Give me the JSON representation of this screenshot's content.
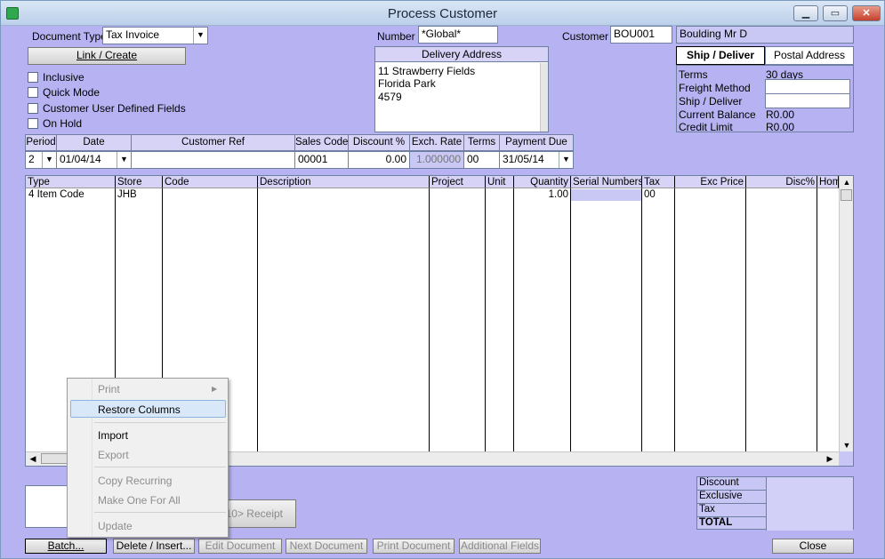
{
  "window": {
    "title": "Process Customer",
    "close_glyph": "✕",
    "max_glyph": "▭",
    "min_glyph": "▁"
  },
  "doc_type": {
    "label": "Document Type",
    "value": "Tax Invoice"
  },
  "link_create_label": "Link / Create",
  "options": [
    {
      "label": "Inclusive",
      "checked": false
    },
    {
      "label": "Quick Mode",
      "checked": false
    },
    {
      "label": "Customer User Defined Fields",
      "checked": false
    },
    {
      "label": "On Hold",
      "checked": false
    }
  ],
  "number": {
    "label": "Number",
    "value": "*Global*"
  },
  "delivery": {
    "title": "Delivery Address",
    "lines": [
      "11 Strawberry Fields",
      "Florida Park",
      "4579"
    ]
  },
  "customer": {
    "label": "Customer",
    "code": "BOU001",
    "name": "Boulding Mr D"
  },
  "address_tabs": {
    "ship": "Ship / Deliver",
    "postal": "Postal Address"
  },
  "cust_info": {
    "terms_label": "Terms",
    "terms_value": "30 days",
    "freight_label": "Freight Method",
    "freight_value": "",
    "ship_label": "Ship / Deliver",
    "ship_value": "",
    "balance_label": "Current Balance",
    "balance_value": "R0.00",
    "credit_label": "Credit Limit",
    "credit_value": "R0.00"
  },
  "header_row": {
    "period": {
      "label": "Period",
      "value": "2"
    },
    "date": {
      "label": "Date",
      "value": "01/04/14"
    },
    "customer_ref": {
      "label": "Customer Ref",
      "value": ""
    },
    "sales_code": {
      "label": "Sales Code",
      "value": "00001"
    },
    "discount": {
      "label": "Discount %",
      "value": "0.00"
    },
    "exch_rate": {
      "label": "Exch. Rate",
      "value": "1.000000"
    },
    "terms": {
      "label": "Terms",
      "value": "00"
    },
    "payment_due": {
      "label": "Payment Due",
      "value": "31/05/14"
    }
  },
  "grid": {
    "columns": [
      "Type",
      "Store",
      "Code",
      "Description",
      "Project",
      "Unit",
      "Quantity",
      "Serial Numbers",
      "Tax",
      "Exc Price",
      "Disc%",
      "Hom"
    ],
    "row": {
      "type": "4  Item Code",
      "store": "JHB",
      "quantity": "1.00",
      "tax": "00"
    }
  },
  "context_menu": {
    "print": "Print",
    "restore_columns": "Restore Columns",
    "import": "Import",
    "export": "Export",
    "copy_recurring": "Copy Recurring",
    "make_one_for_all": "Make One For All",
    "update": "Update",
    "submenu_arrow": "▶"
  },
  "receipt_label": "F10> Receipt",
  "totals": {
    "discount": "Discount",
    "exclusive": "Exclusive",
    "tax": "Tax",
    "total": "TOTAL"
  },
  "buttons": {
    "batch": "Batch...",
    "delete_insert": "Delete / Insert...",
    "edit_document": "Edit Document",
    "next_document": "Next Document",
    "print_document": "Print Document",
    "additional_fields": "Additional Fields",
    "close": "Close"
  },
  "glyphs": {
    "dropdown": "▼",
    "scroll_up": "▲",
    "scroll_down": "▼",
    "scroll_left": "◀",
    "scroll_right": "▶"
  },
  "colors": {
    "window_bg": "#b7b3f2",
    "selection": "#cfe3f7",
    "title_bg": "#d9e6f5"
  }
}
